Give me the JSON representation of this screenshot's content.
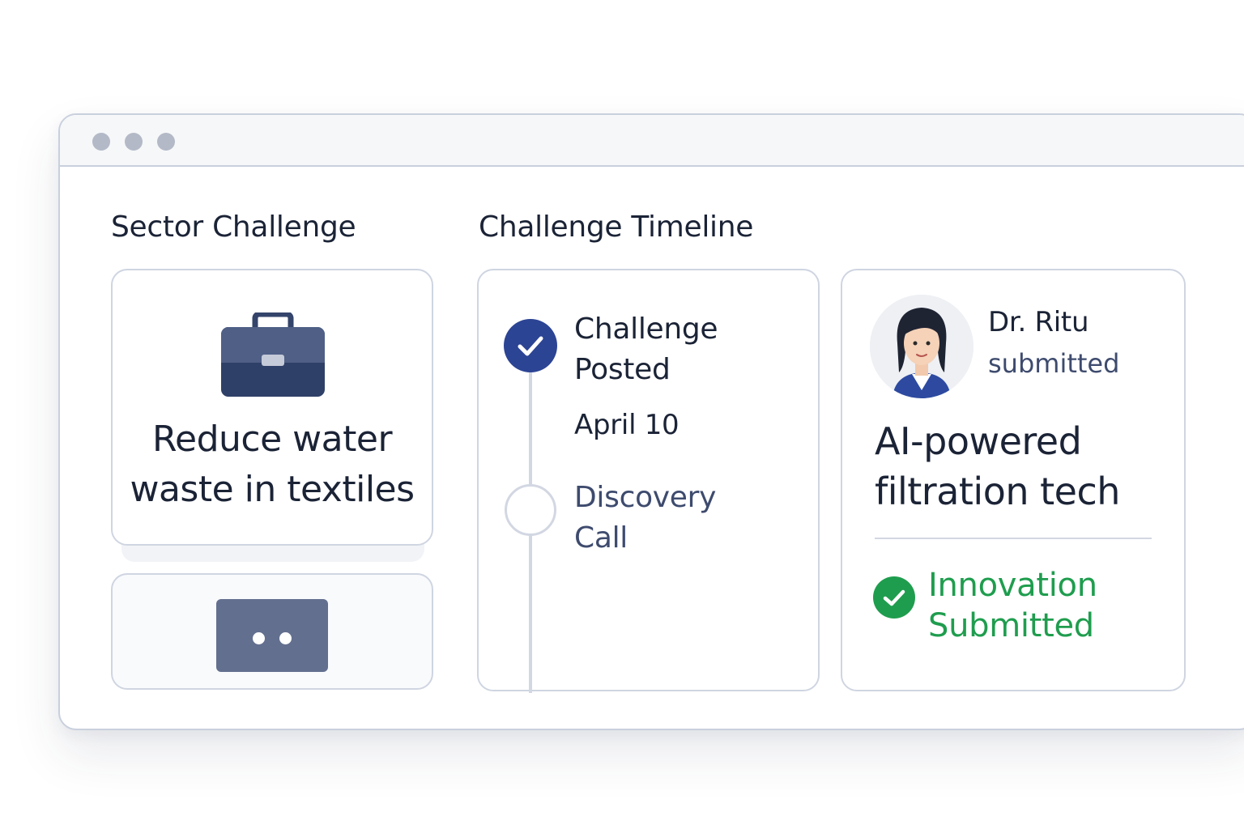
{
  "window": {
    "controls": [
      "control-dot",
      "control-dot",
      "control-dot"
    ]
  },
  "sector": {
    "heading": "Sector Challenge",
    "icon": "briefcase-icon",
    "challenge_line1": "Reduce water",
    "challenge_line2": "waste in textiles",
    "more_icon": "more-dots-icon"
  },
  "timeline": {
    "heading": "Challenge Timeline",
    "steps": [
      {
        "label_line1": "Challenge",
        "label_line2": "Posted",
        "date": "April 10",
        "status": "done",
        "icon": "check-icon"
      },
      {
        "label_line1": "Discovery",
        "label_line2": "Call",
        "status": "pending",
        "icon": "empty-circle-icon"
      }
    ]
  },
  "submission": {
    "name": "Dr. Ritu",
    "action": "submitted",
    "title_line1": "AI-powered",
    "title_line2": "filtration tech",
    "status_line1": "Innovation",
    "status_line2": "Submitted",
    "status_icon": "check-circle-icon"
  },
  "colors": {
    "accent_navy": "#2c4494",
    "success_green": "#1f9d4e",
    "text_dark": "#1b2336",
    "text_muted": "#3e4b6e",
    "border": "#cfd5e1"
  }
}
